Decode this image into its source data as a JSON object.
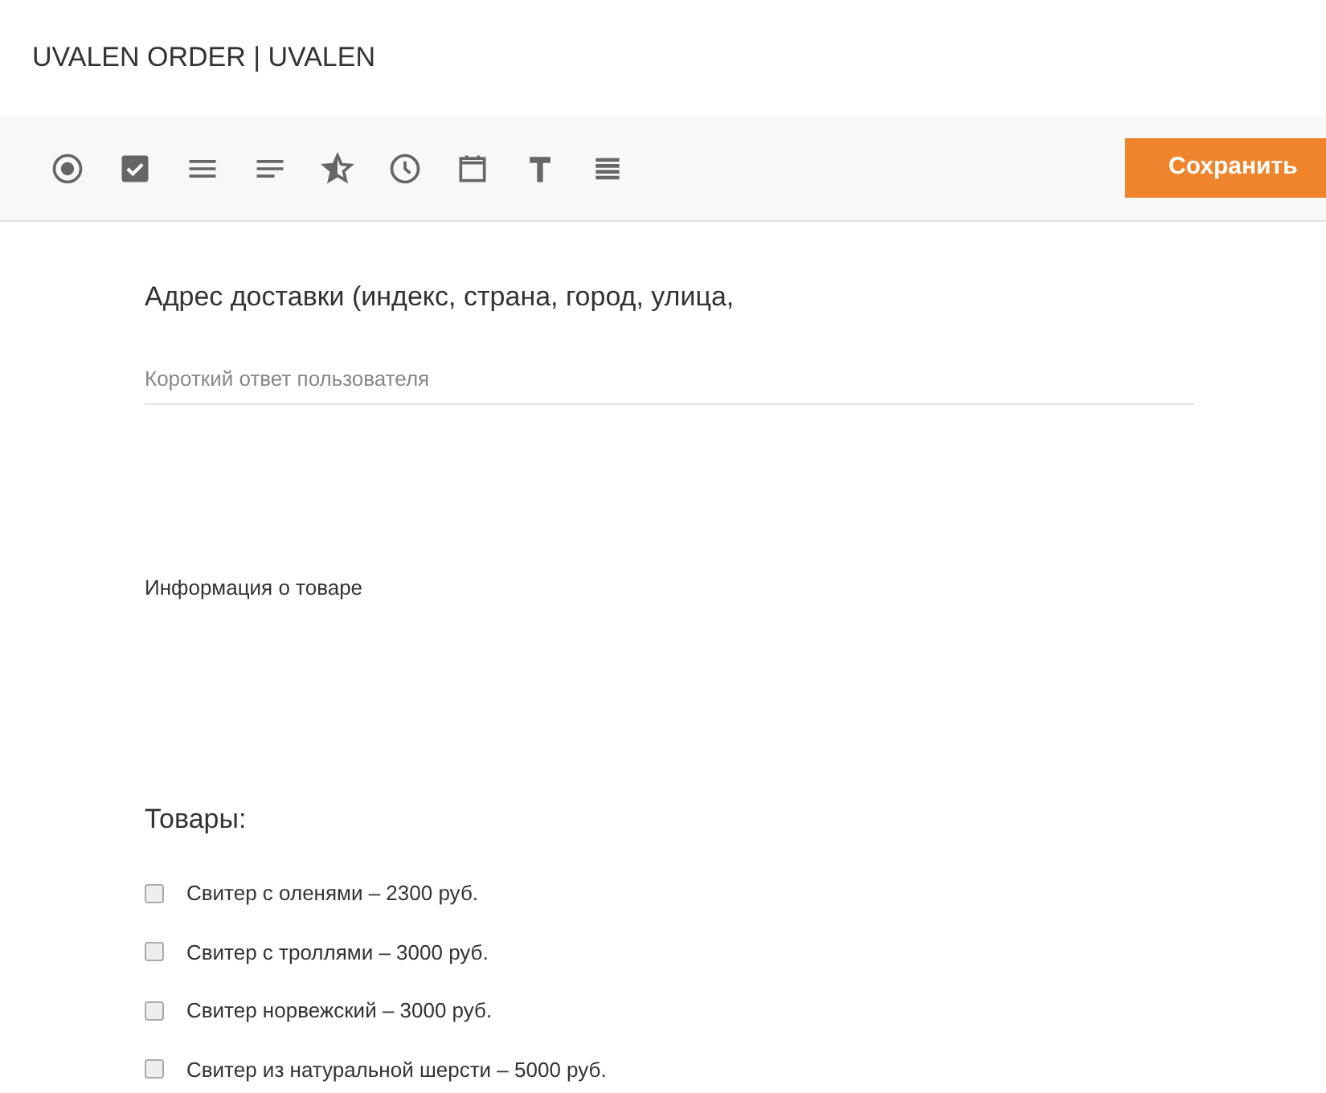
{
  "header": {
    "title": "UVALEN ORDER | UVALEN"
  },
  "toolbar": {
    "save_button": "Сохранить"
  },
  "question": {
    "title": "Адрес доставки (индекс, страна, город, улица,",
    "placeholder": "Короткий ответ пользователя"
  },
  "info_text": "Информация о товаре",
  "products": {
    "title": "Товары:",
    "options": [
      {
        "label": "Свитер с оленями – 2300 руб.",
        "checked": false
      },
      {
        "label": "Свитер с троллями – 3000 руб.",
        "checked": false
      },
      {
        "label": "Свитер норвежский – 3000 руб.",
        "checked": false
      },
      {
        "label": "Свитер из натуральной шерсти – 5000 руб.",
        "checked": false
      }
    ]
  }
}
